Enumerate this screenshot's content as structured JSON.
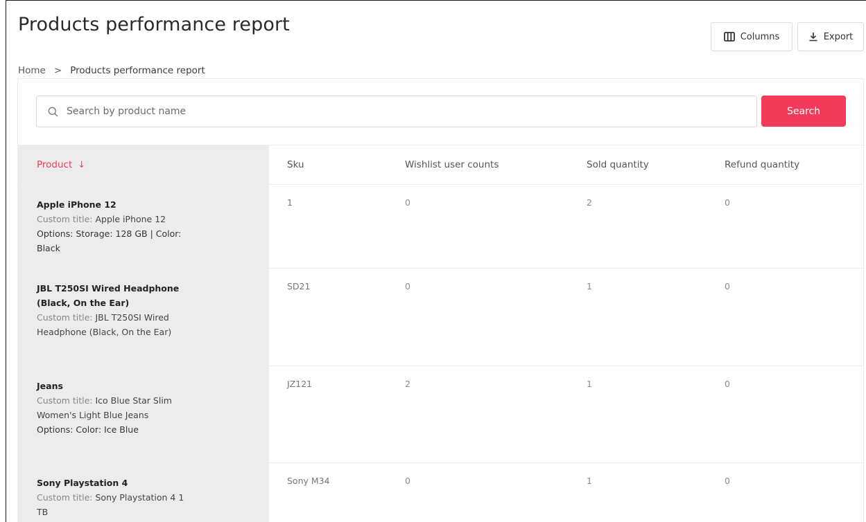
{
  "header": {
    "title": "Products performance report",
    "breadcrumb": {
      "home": "Home",
      "separator": ">",
      "current": "Products performance report"
    },
    "columns_label": "Columns",
    "export_label": "Export"
  },
  "search": {
    "placeholder": "Search by product name",
    "value": "",
    "button_label": "Search"
  },
  "table": {
    "columns": {
      "product": "Product",
      "sku": "Sku",
      "wishlist": "Wishlist user counts",
      "sold": "Sold quantity",
      "refund": "Refund quantity"
    },
    "sort_indicator": "↓",
    "rows": [
      {
        "name": "Apple iPhone 12",
        "custom_label": "Custom title:",
        "custom_title": "Apple iPhone 12",
        "options": "Options: Storage: 128 GB | Color: Black",
        "sku": "1",
        "wishlist": "0",
        "sold": "2",
        "refund": "0"
      },
      {
        "name": "JBL T250SI Wired Headphone (Black, On the Ear)",
        "custom_label": "Custom title:",
        "custom_title": "JBL T250SI Wired Headphone (Black, On the Ear)",
        "options": "",
        "sku": "SD21",
        "wishlist": "0",
        "sold": "1",
        "refund": "0"
      },
      {
        "name": "Jeans",
        "custom_label": "Custom title:",
        "custom_title": "Ico Blue Star Slim Women's Light Blue Jeans",
        "options": "Options: Color: Ice Blue",
        "sku": "JZ121",
        "wishlist": "2",
        "sold": "1",
        "refund": "0"
      },
      {
        "name": "Sony Playstation 4",
        "custom_label": "Custom title:",
        "custom_title": "Sony Playstation 4 1 TB",
        "options": "",
        "sku": "Sony M34",
        "wishlist": "0",
        "sold": "1",
        "refund": "0"
      }
    ]
  },
  "colors": {
    "accent": "#f43a5a",
    "product_column_bg": "#ececec"
  }
}
